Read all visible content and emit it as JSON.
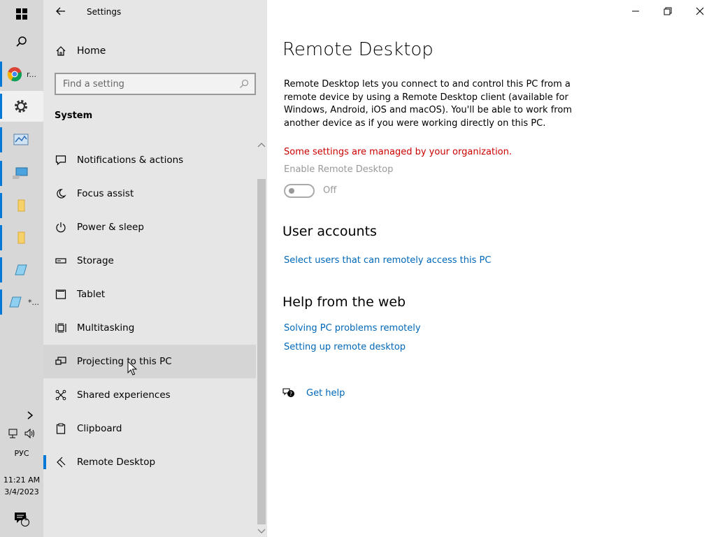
{
  "window": {
    "title": "Settings",
    "controls": [
      "minimize",
      "restore",
      "close"
    ]
  },
  "taskbar": {
    "apps": [
      {
        "name": "chrome",
        "label": "r..."
      },
      {
        "name": "settings",
        "label": ""
      },
      {
        "name": "control-panel",
        "label": ""
      },
      {
        "name": "computer",
        "label": ""
      },
      {
        "name": "folder",
        "label": ""
      },
      {
        "name": "folder",
        "label": ""
      },
      {
        "name": "notepad",
        "label": ""
      },
      {
        "name": "notepad",
        "label": "*..."
      }
    ],
    "language": "РУС",
    "time": "11:21 AM",
    "date": "3/4/2023",
    "notification_count": "1"
  },
  "nav": {
    "home_label": "Home",
    "search_placeholder": "Find a setting",
    "section": "System",
    "items": [
      {
        "label": "Notifications & actions",
        "icon": "notification-icon"
      },
      {
        "label": "Focus assist",
        "icon": "moon-icon"
      },
      {
        "label": "Power & sleep",
        "icon": "power-icon"
      },
      {
        "label": "Storage",
        "icon": "storage-icon"
      },
      {
        "label": "Tablet",
        "icon": "tablet-icon"
      },
      {
        "label": "Multitasking",
        "icon": "multitasking-icon"
      },
      {
        "label": "Projecting to this PC",
        "icon": "projecting-icon"
      },
      {
        "label": "Shared experiences",
        "icon": "shared-experiences-icon"
      },
      {
        "label": "Clipboard",
        "icon": "clipboard-icon"
      },
      {
        "label": "Remote Desktop",
        "icon": "remote-desktop-icon"
      }
    ]
  },
  "content": {
    "title": "Remote Desktop",
    "description": "Remote Desktop lets you connect to and control this PC from a remote device by using a Remote Desktop client (available for Windows, Android, iOS and macOS). You'll be able to work from another device as if you were working directly on this PC.",
    "managed_notice": "Some settings are managed by your organization.",
    "toggle_label": "Enable Remote Desktop",
    "toggle_state": "Off",
    "user_accounts_heading": "User accounts",
    "select_users_link": "Select users that can remotely access this PC",
    "help_heading": "Help from the web",
    "help_links": [
      "Solving PC problems remotely",
      "Setting up remote desktop"
    ],
    "get_help": "Get help"
  },
  "colors": {
    "accent": "#0078d7",
    "link": "#0067b8",
    "warning": "#cc0000",
    "nav_bg": "#e6e6e6",
    "taskbar_bg": "#d7d7d7"
  }
}
